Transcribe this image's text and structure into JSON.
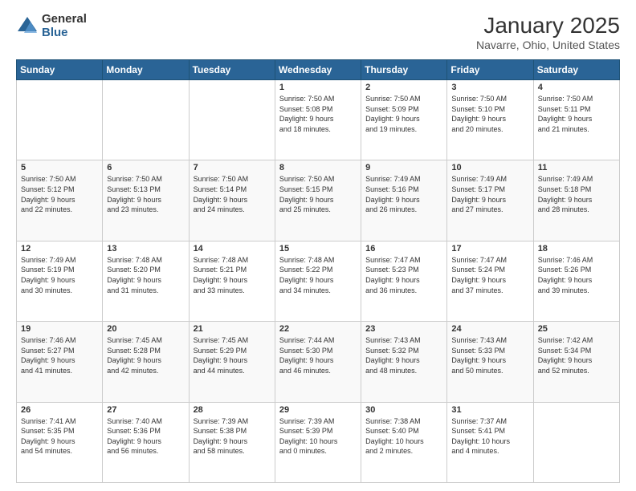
{
  "header": {
    "logo_general": "General",
    "logo_blue": "Blue",
    "title": "January 2025",
    "location": "Navarre, Ohio, United States"
  },
  "days_of_week": [
    "Sunday",
    "Monday",
    "Tuesday",
    "Wednesday",
    "Thursday",
    "Friday",
    "Saturday"
  ],
  "weeks": [
    [
      {
        "day": "",
        "info": ""
      },
      {
        "day": "",
        "info": ""
      },
      {
        "day": "",
        "info": ""
      },
      {
        "day": "1",
        "info": "Sunrise: 7:50 AM\nSunset: 5:08 PM\nDaylight: 9 hours\nand 18 minutes."
      },
      {
        "day": "2",
        "info": "Sunrise: 7:50 AM\nSunset: 5:09 PM\nDaylight: 9 hours\nand 19 minutes."
      },
      {
        "day": "3",
        "info": "Sunrise: 7:50 AM\nSunset: 5:10 PM\nDaylight: 9 hours\nand 20 minutes."
      },
      {
        "day": "4",
        "info": "Sunrise: 7:50 AM\nSunset: 5:11 PM\nDaylight: 9 hours\nand 21 minutes."
      }
    ],
    [
      {
        "day": "5",
        "info": "Sunrise: 7:50 AM\nSunset: 5:12 PM\nDaylight: 9 hours\nand 22 minutes."
      },
      {
        "day": "6",
        "info": "Sunrise: 7:50 AM\nSunset: 5:13 PM\nDaylight: 9 hours\nand 23 minutes."
      },
      {
        "day": "7",
        "info": "Sunrise: 7:50 AM\nSunset: 5:14 PM\nDaylight: 9 hours\nand 24 minutes."
      },
      {
        "day": "8",
        "info": "Sunrise: 7:50 AM\nSunset: 5:15 PM\nDaylight: 9 hours\nand 25 minutes."
      },
      {
        "day": "9",
        "info": "Sunrise: 7:49 AM\nSunset: 5:16 PM\nDaylight: 9 hours\nand 26 minutes."
      },
      {
        "day": "10",
        "info": "Sunrise: 7:49 AM\nSunset: 5:17 PM\nDaylight: 9 hours\nand 27 minutes."
      },
      {
        "day": "11",
        "info": "Sunrise: 7:49 AM\nSunset: 5:18 PM\nDaylight: 9 hours\nand 28 minutes."
      }
    ],
    [
      {
        "day": "12",
        "info": "Sunrise: 7:49 AM\nSunset: 5:19 PM\nDaylight: 9 hours\nand 30 minutes."
      },
      {
        "day": "13",
        "info": "Sunrise: 7:48 AM\nSunset: 5:20 PM\nDaylight: 9 hours\nand 31 minutes."
      },
      {
        "day": "14",
        "info": "Sunrise: 7:48 AM\nSunset: 5:21 PM\nDaylight: 9 hours\nand 33 minutes."
      },
      {
        "day": "15",
        "info": "Sunrise: 7:48 AM\nSunset: 5:22 PM\nDaylight: 9 hours\nand 34 minutes."
      },
      {
        "day": "16",
        "info": "Sunrise: 7:47 AM\nSunset: 5:23 PM\nDaylight: 9 hours\nand 36 minutes."
      },
      {
        "day": "17",
        "info": "Sunrise: 7:47 AM\nSunset: 5:24 PM\nDaylight: 9 hours\nand 37 minutes."
      },
      {
        "day": "18",
        "info": "Sunrise: 7:46 AM\nSunset: 5:26 PM\nDaylight: 9 hours\nand 39 minutes."
      }
    ],
    [
      {
        "day": "19",
        "info": "Sunrise: 7:46 AM\nSunset: 5:27 PM\nDaylight: 9 hours\nand 41 minutes."
      },
      {
        "day": "20",
        "info": "Sunrise: 7:45 AM\nSunset: 5:28 PM\nDaylight: 9 hours\nand 42 minutes."
      },
      {
        "day": "21",
        "info": "Sunrise: 7:45 AM\nSunset: 5:29 PM\nDaylight: 9 hours\nand 44 minutes."
      },
      {
        "day": "22",
        "info": "Sunrise: 7:44 AM\nSunset: 5:30 PM\nDaylight: 9 hours\nand 46 minutes."
      },
      {
        "day": "23",
        "info": "Sunrise: 7:43 AM\nSunset: 5:32 PM\nDaylight: 9 hours\nand 48 minutes."
      },
      {
        "day": "24",
        "info": "Sunrise: 7:43 AM\nSunset: 5:33 PM\nDaylight: 9 hours\nand 50 minutes."
      },
      {
        "day": "25",
        "info": "Sunrise: 7:42 AM\nSunset: 5:34 PM\nDaylight: 9 hours\nand 52 minutes."
      }
    ],
    [
      {
        "day": "26",
        "info": "Sunrise: 7:41 AM\nSunset: 5:35 PM\nDaylight: 9 hours\nand 54 minutes."
      },
      {
        "day": "27",
        "info": "Sunrise: 7:40 AM\nSunset: 5:36 PM\nDaylight: 9 hours\nand 56 minutes."
      },
      {
        "day": "28",
        "info": "Sunrise: 7:39 AM\nSunset: 5:38 PM\nDaylight: 9 hours\nand 58 minutes."
      },
      {
        "day": "29",
        "info": "Sunrise: 7:39 AM\nSunset: 5:39 PM\nDaylight: 10 hours\nand 0 minutes."
      },
      {
        "day": "30",
        "info": "Sunrise: 7:38 AM\nSunset: 5:40 PM\nDaylight: 10 hours\nand 2 minutes."
      },
      {
        "day": "31",
        "info": "Sunrise: 7:37 AM\nSunset: 5:41 PM\nDaylight: 10 hours\nand 4 minutes."
      },
      {
        "day": "",
        "info": ""
      }
    ]
  ]
}
